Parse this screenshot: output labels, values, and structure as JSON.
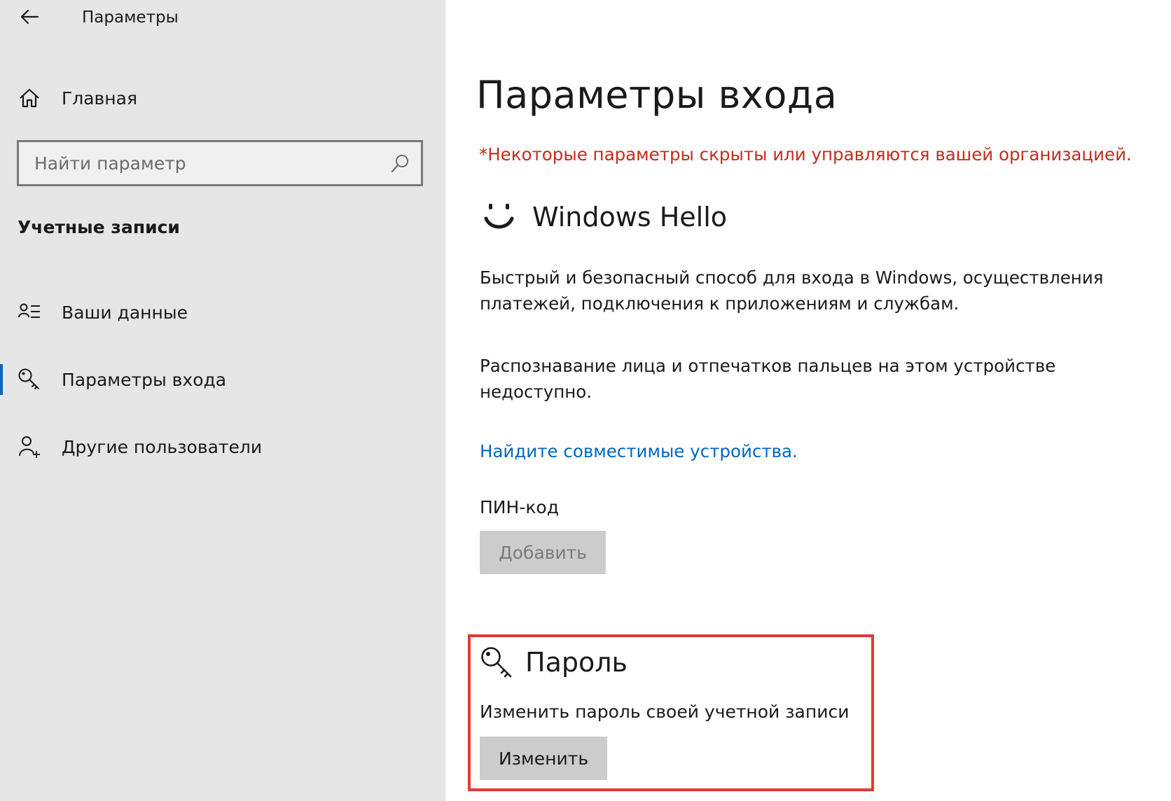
{
  "window": {
    "title": "Параметры"
  },
  "sidebar": {
    "home_label": "Главная",
    "search_placeholder": "Найти параметр",
    "section_heading": "Учетные записи",
    "items": [
      {
        "label": "Ваши данные",
        "icon": "user-info-icon"
      },
      {
        "label": "Параметры входа",
        "icon": "key-icon",
        "selected": true
      },
      {
        "label": "Другие пользователи",
        "icon": "add-user-icon"
      }
    ]
  },
  "main": {
    "page_title": "Параметры входа",
    "org_notice": "*Некоторые параметры скрыты или управляются вашей организацией.",
    "hello": {
      "title": "Windows Hello",
      "icon": "smiley-icon",
      "description": "Быстрый и безопасный способ для входа в Windows, осуществления платежей, подключения к приложениям и службам.",
      "unavailable_text": "Распознавание лица и отпечатков пальцев на этом устройстве недоступно.",
      "link_label": "Найдите совместимые устройства."
    },
    "pin": {
      "label": "ПИН-код",
      "button_label": "Добавить"
    },
    "password": {
      "title": "Пароль",
      "icon": "key-icon",
      "description": "Изменить пароль своей учетной записи",
      "button_label": "Изменить"
    }
  },
  "colors": {
    "sidebar_bg": "#e6e6e6",
    "accent": "#0067c0",
    "warning": "#c42b1c",
    "highlight": "#e23b2e",
    "button_bg": "#cccccc"
  }
}
